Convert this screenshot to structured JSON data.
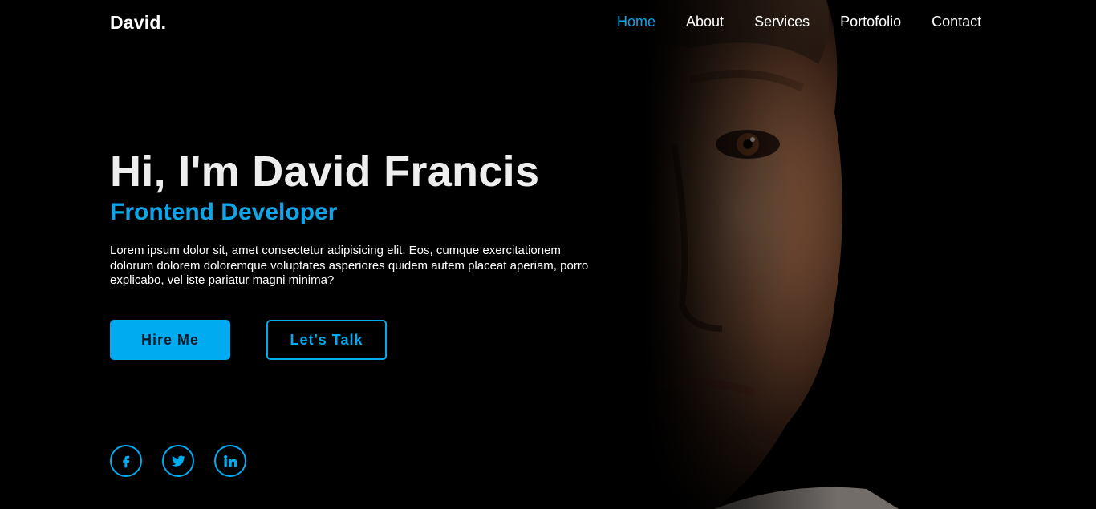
{
  "header": {
    "logo": "David.",
    "nav": [
      {
        "label": "Home",
        "active": true
      },
      {
        "label": "About",
        "active": false
      },
      {
        "label": "Services",
        "active": false
      },
      {
        "label": "Portofolio",
        "active": false
      },
      {
        "label": "Contact",
        "active": false
      }
    ]
  },
  "hero": {
    "title": "Hi, I'm David Francis",
    "subtitle": "Frontend Developer",
    "description": "Lorem ipsum dolor sit, amet consectetur adipisicing elit. Eos, cumque exercitationem dolorum dolorem doloremque voluptates asperiores quidem autem placeat aperiam, porro explicabo, vel iste pariatur magni minima?",
    "buttons": {
      "hire": "Hire Me",
      "talk": "Let's Talk"
    }
  },
  "social": [
    {
      "name": "facebook-icon"
    },
    {
      "name": "twitter-icon"
    },
    {
      "name": "linkedin-icon"
    }
  ],
  "colors": {
    "accent": "#00abf0",
    "background": "#000000",
    "text": "#ffffff"
  }
}
